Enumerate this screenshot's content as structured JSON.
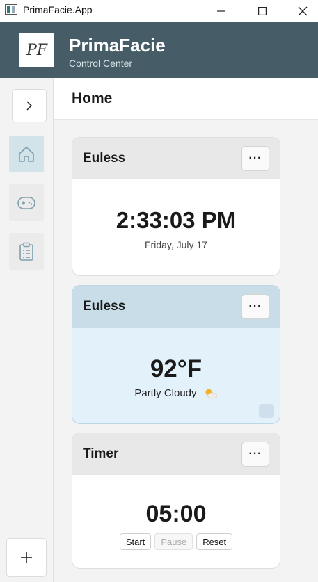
{
  "window": {
    "title": "PrimaFacie.App"
  },
  "header": {
    "logo_text": "PF",
    "title": "PrimaFacie",
    "subtitle": "Control Center"
  },
  "sidebar": {
    "items": [
      {
        "icon": "home-icon",
        "active": true
      },
      {
        "icon": "gamepad-icon",
        "active": false
      },
      {
        "icon": "clipboard-list-icon",
        "active": false
      }
    ]
  },
  "main": {
    "title": "Home"
  },
  "cards": {
    "clock": {
      "title": "Euless",
      "menu_label": "···",
      "time": "2:33:03 PM",
      "date": "Friday, July 17"
    },
    "weather": {
      "title": "Euless",
      "menu_label": "···",
      "temperature": "92°F",
      "condition": "Partly Cloudy",
      "icon": "partly-cloudy-icon"
    },
    "timer": {
      "title": "Timer",
      "menu_label": "···",
      "value": "05:00",
      "start_label": "Start",
      "pause_label": "Pause",
      "reset_label": "Reset"
    }
  },
  "colors": {
    "header_bg": "#465d67",
    "weather_card_bg": "#e3f1fb",
    "weather_head_bg": "#c8dde8",
    "active_nav_bg": "#d3e3ea"
  }
}
